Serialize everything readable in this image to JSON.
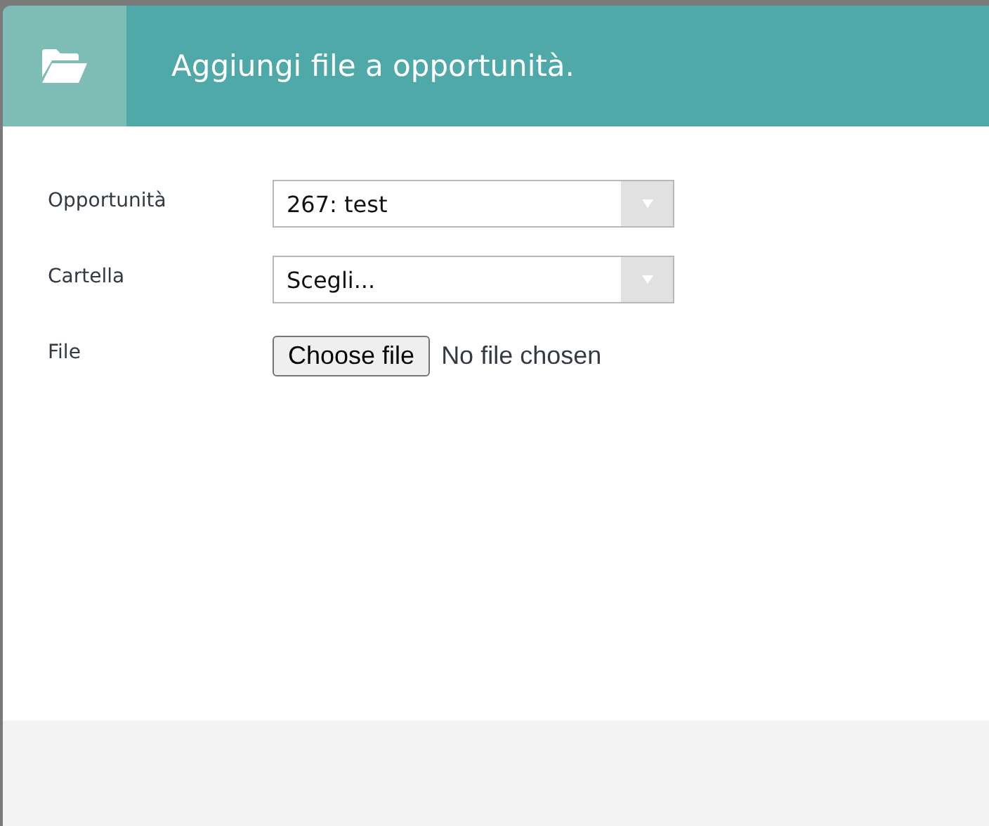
{
  "dialog": {
    "title": "Aggiungi file a opportunità.",
    "fields": [
      {
        "kind": "select",
        "label": "Opportunità",
        "value": "267: test"
      },
      {
        "kind": "select",
        "label": "Cartella",
        "value": "Scegli..."
      },
      {
        "kind": "file",
        "label": "File",
        "button": "Choose file",
        "status": "No file chosen"
      }
    ]
  }
}
